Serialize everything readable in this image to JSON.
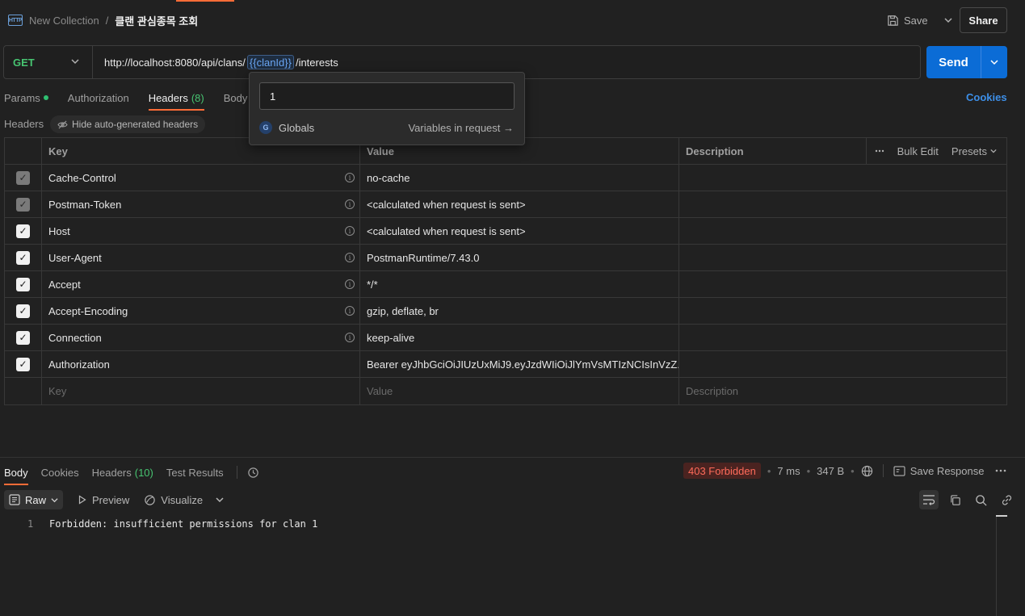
{
  "header": {
    "collection": "New Collection",
    "separator": "/",
    "request_name": "클랜 관심종목 조회",
    "save_label": "Save",
    "share_label": "Share",
    "http_icon_text": "HTTP"
  },
  "request": {
    "method": "GET",
    "url_prefix": "http://localhost:8080/api/clans/",
    "url_variable": "{{clanId}}",
    "url_suffix": "/interests",
    "send_label": "Send"
  },
  "variable_popover": {
    "value": "1",
    "scope_badge": "G",
    "scope": "Globals",
    "link": "Variables in request →"
  },
  "tabs": {
    "params": "Params",
    "authorization": "Authorization",
    "headers": "Headers",
    "headers_count": "(8)",
    "body": "Body",
    "cookies": "Cookies"
  },
  "headers_section": {
    "label": "Headers",
    "hide_auto": "Hide auto-generated headers",
    "col_key": "Key",
    "col_value": "Value",
    "col_description": "Description",
    "bulk_edit": "Bulk Edit",
    "presets": "Presets",
    "rows": [
      {
        "key": "Cache-Control",
        "value": "no-cache"
      },
      {
        "key": "Postman-Token",
        "value": "<calculated when request is sent>"
      },
      {
        "key": "Host",
        "value": "<calculated when request is sent>"
      },
      {
        "key": "User-Agent",
        "value": "PostmanRuntime/7.43.0"
      },
      {
        "key": "Accept",
        "value": "*/*"
      },
      {
        "key": "Accept-Encoding",
        "value": "gzip, deflate, br"
      },
      {
        "key": "Connection",
        "value": "keep-alive"
      },
      {
        "key": "Authorization",
        "value": "Bearer eyJhbGciOiJIUzUxMiJ9.eyJzdWIiOiJlYmVsMTIzNCIsInVzZ..."
      }
    ],
    "placeholder_key": "Key",
    "placeholder_value": "Value",
    "placeholder_description": "Description"
  },
  "response": {
    "tabs": {
      "body": "Body",
      "cookies": "Cookies",
      "headers": "Headers",
      "headers_count": "(10)",
      "test_results": "Test Results"
    },
    "status": "403 Forbidden",
    "time": "7 ms",
    "size": "347 B",
    "save_response": "Save Response",
    "format": "Raw",
    "preview": "Preview",
    "visualize": "Visualize",
    "line_number": "1",
    "body_text": "Forbidden: insufficient permissions for clan 1"
  },
  "colors": {
    "accent": "#ff6c37",
    "send": "#0b6cd6",
    "method_get": "#47c471",
    "status_error": "#ff6b5a"
  }
}
